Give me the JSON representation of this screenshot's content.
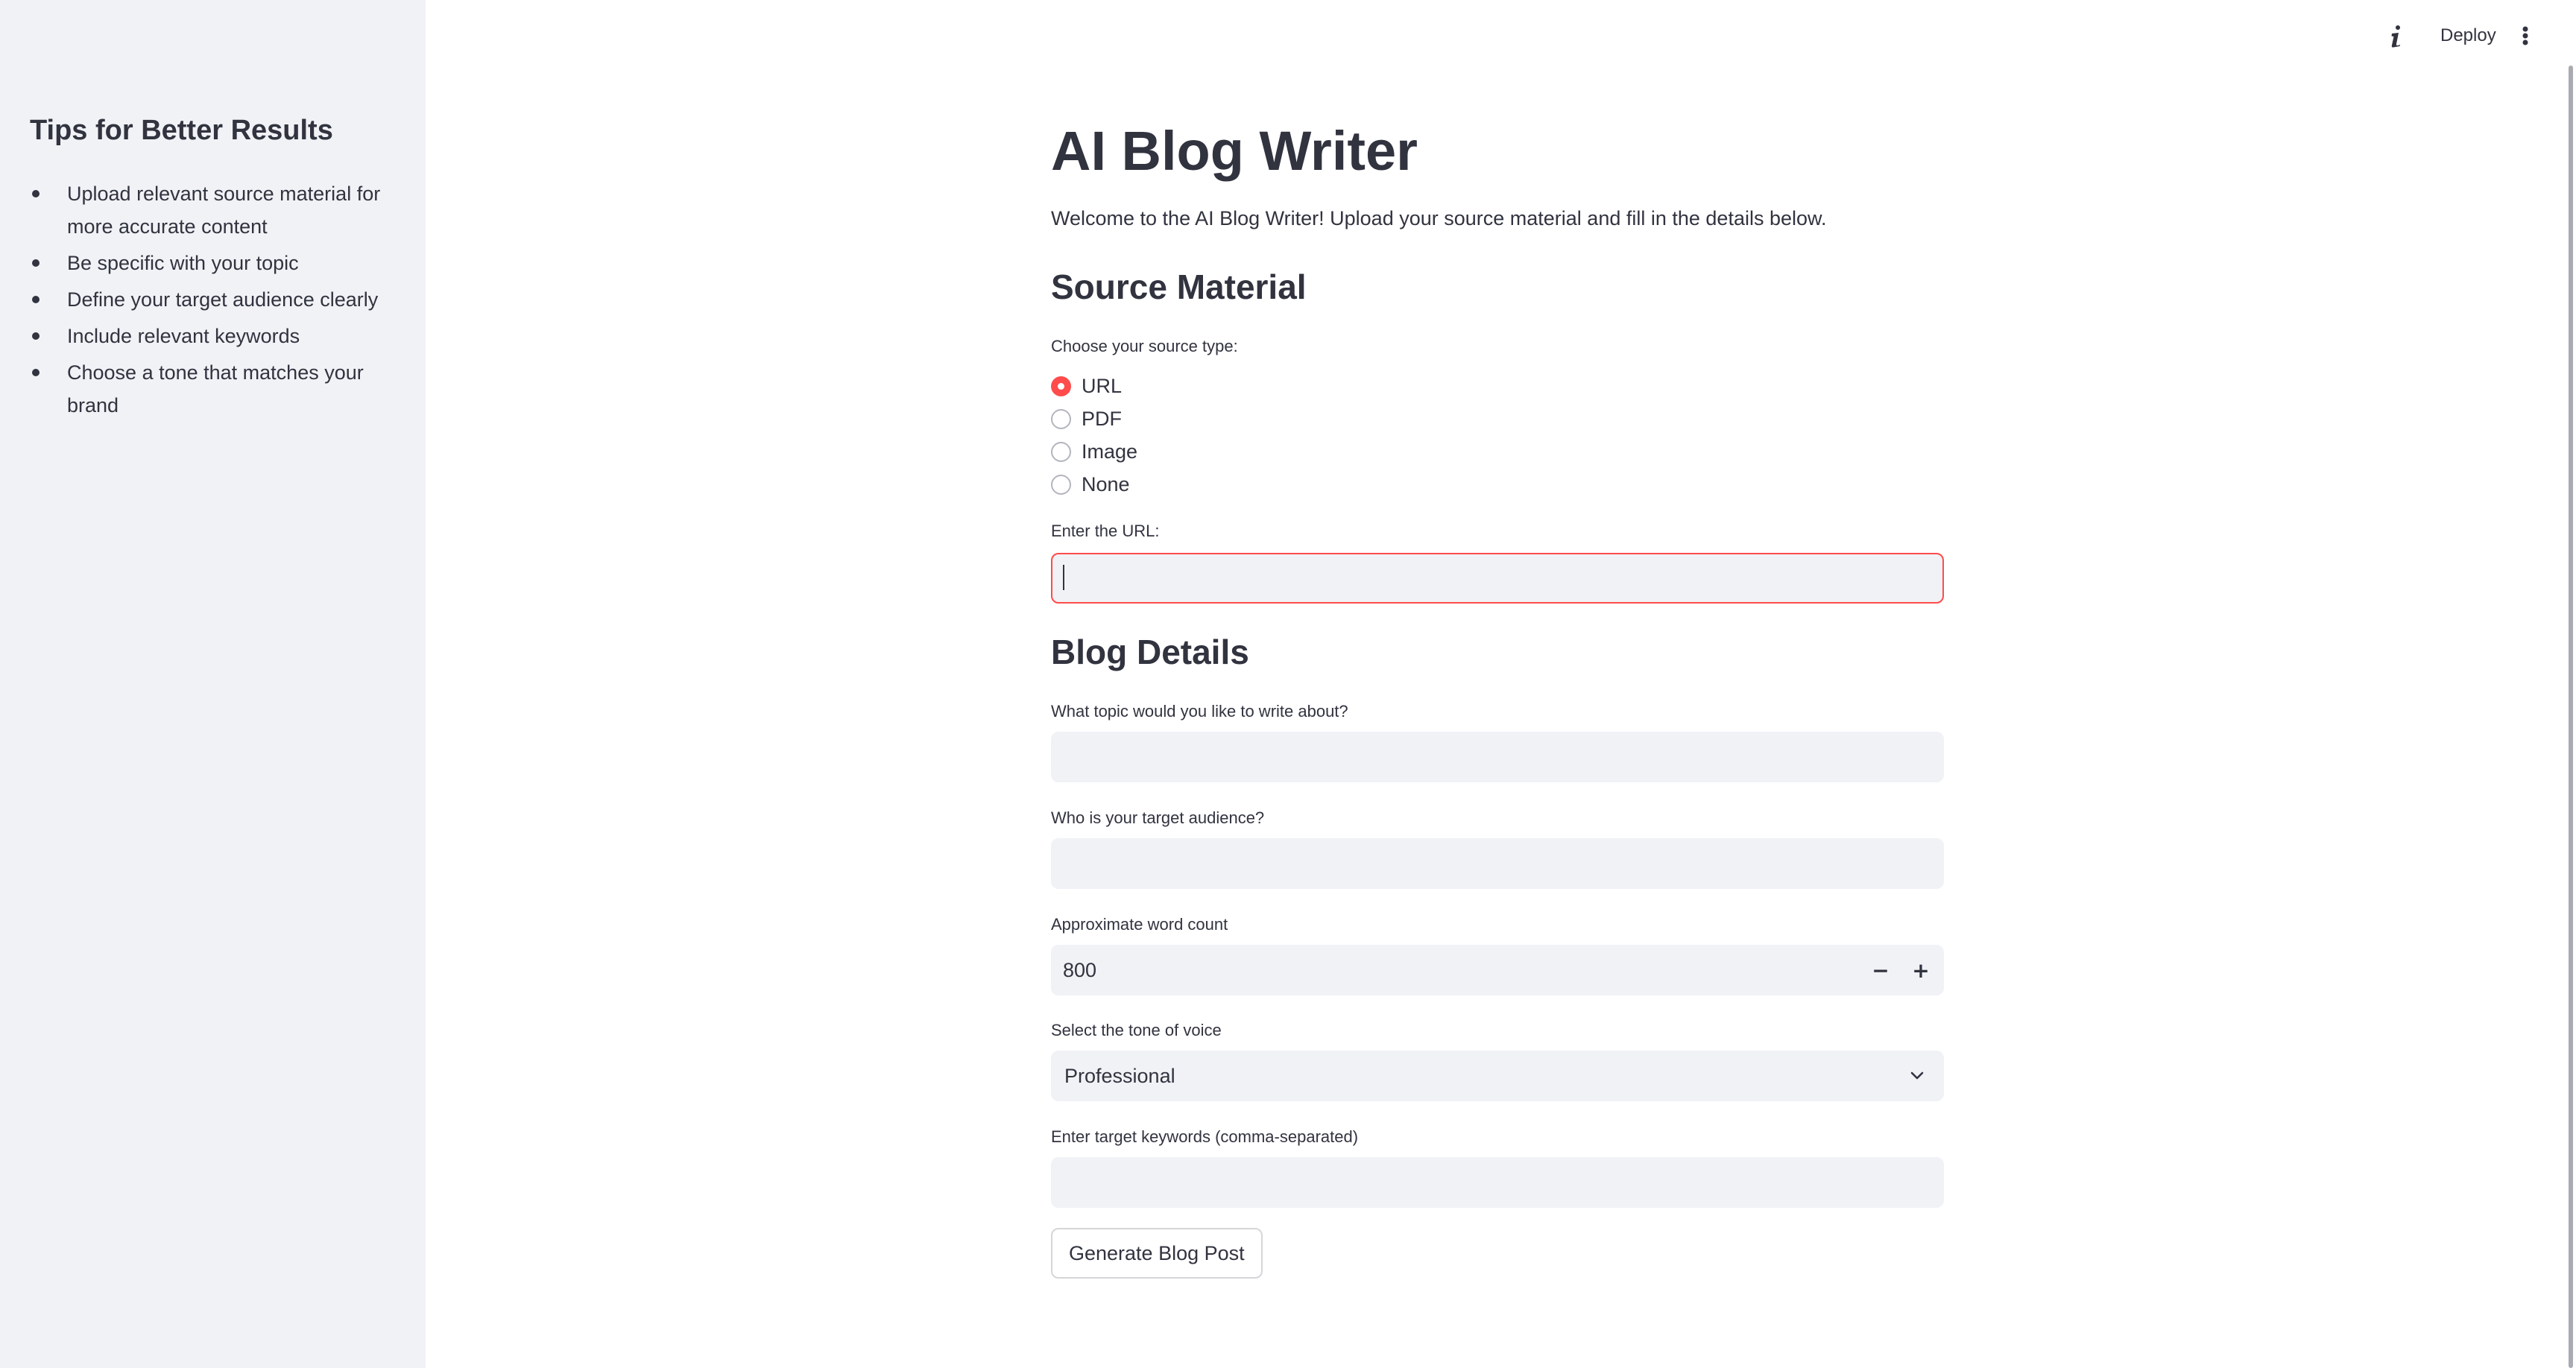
{
  "sidebar": {
    "title": "Tips for Better Results",
    "tips": [
      "Upload relevant source material for more accurate content",
      "Be specific with your topic",
      "Define your target audience clearly",
      "Include relevant keywords",
      "Choose a tone that matches your brand"
    ]
  },
  "header": {
    "info_icon": "info-icon",
    "deploy_label": "Deploy",
    "menu_icon": "more-vertical-icon"
  },
  "main": {
    "title": "AI Blog Writer",
    "welcome": "Welcome to the AI Blog Writer! Upload your source material and fill in the details below.",
    "source_section": {
      "heading": "Source Material",
      "radio_label": "Choose your source type:",
      "options": [
        "URL",
        "PDF",
        "Image",
        "None"
      ],
      "selected": "URL",
      "url_label": "Enter the URL:",
      "url_value": ""
    },
    "blog_section": {
      "heading": "Blog Details",
      "topic_label": "What topic would you like to write about?",
      "topic_value": "",
      "audience_label": "Who is your target audience?",
      "audience_value": "",
      "word_count_label": "Approximate word count",
      "word_count_value": "800",
      "decrement_label": "−",
      "increment_label": "+",
      "tone_label": "Select the tone of voice",
      "tone_value": "Professional",
      "keywords_label": "Enter target keywords (comma-separated)",
      "keywords_value": ""
    },
    "generate_label": "Generate Blog Post"
  },
  "colors": {
    "accent": "#ff4b4b",
    "sidebar_bg": "#f0f2f6",
    "text": "#31333f",
    "input_bg": "#f0f2f6"
  }
}
